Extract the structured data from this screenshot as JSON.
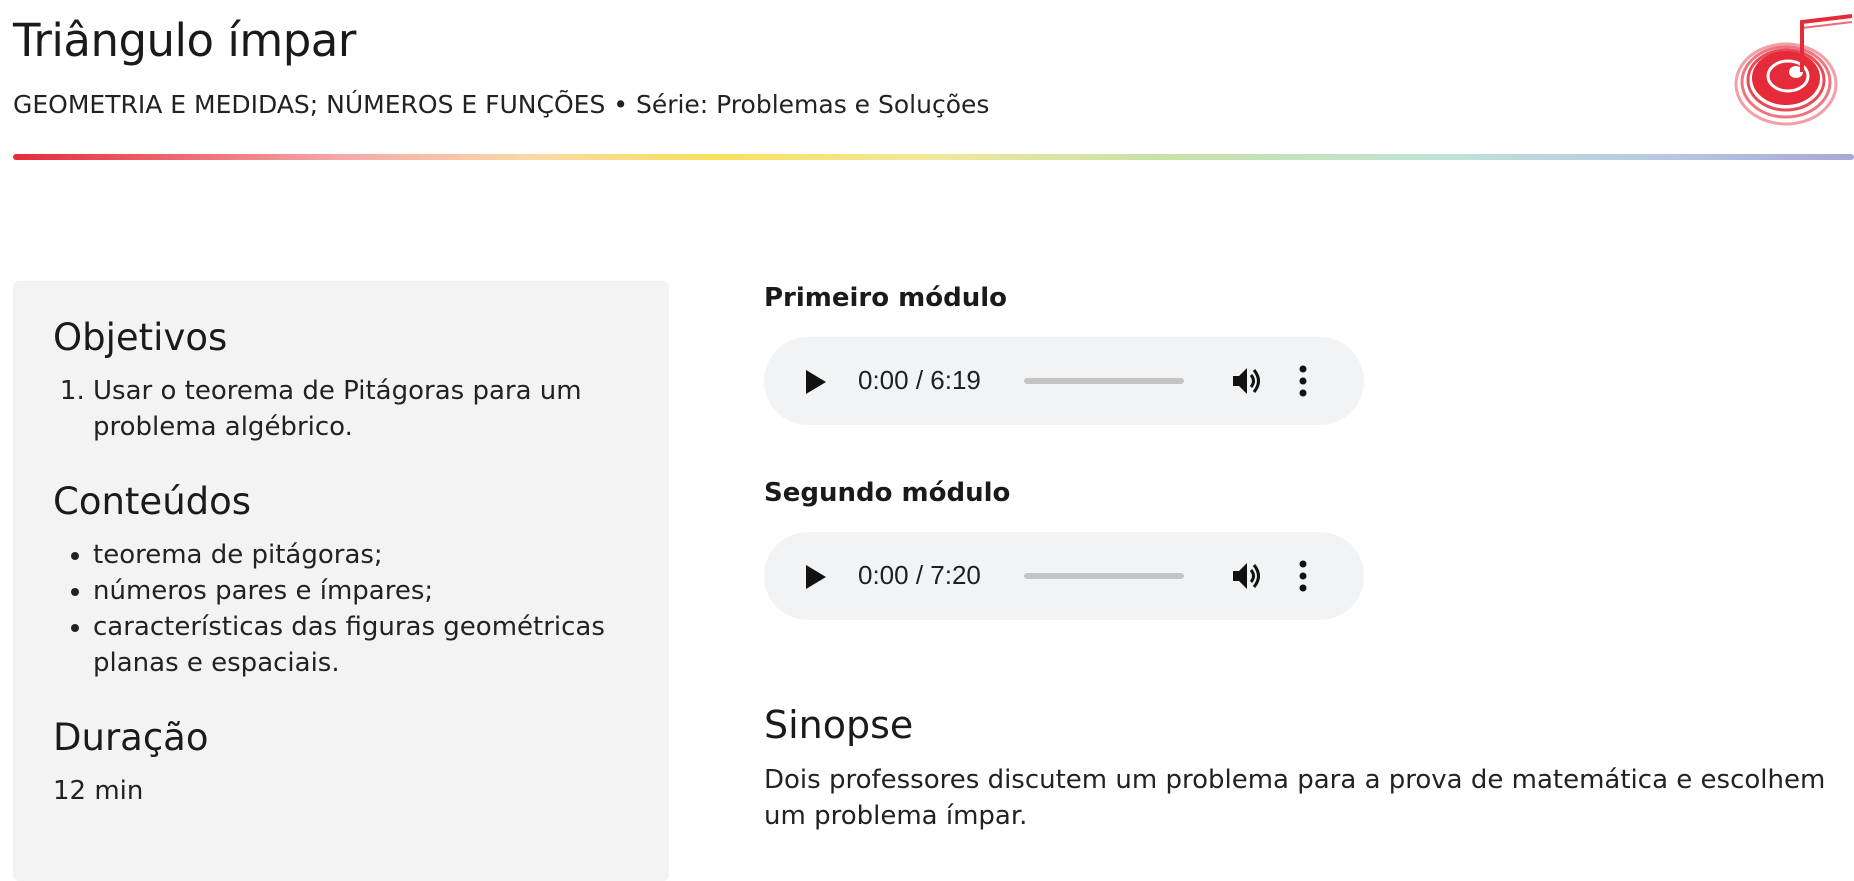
{
  "header": {
    "title": "Triângulo ímpar",
    "subtitle": "GEOMETRIA E MEDIDAS; NÚMEROS E FUNÇÕES • Série: Problemas e Soluções",
    "logo_icon": "music-note-disc-logo"
  },
  "colors": {
    "accent_red": "#e52a39",
    "sidebar_bg": "#f3f3f3",
    "player_bg": "#f1f3f4"
  },
  "sidebar": {
    "objetivos": {
      "heading": "Objetivos",
      "items": [
        "Usar o teorema de Pitágoras para um problema algébrico."
      ]
    },
    "conteudos": {
      "heading": "Conteúdos",
      "items": [
        "teorema de pitágoras;",
        "números pares e ímpares;",
        "características das figuras geométricas planas e espaciais."
      ]
    },
    "duracao": {
      "heading": "Duração",
      "value": "12 min"
    }
  },
  "modules": [
    {
      "label": "Primeiro módulo",
      "time": "0:00 / 6:19",
      "progress": 0,
      "play_icon": "play-icon",
      "volume_icon": "volume-icon",
      "menu_icon": "more-vertical-icon"
    },
    {
      "label": "Segundo módulo",
      "time": "0:00 / 7:20",
      "progress": 0,
      "play_icon": "play-icon",
      "volume_icon": "volume-icon",
      "menu_icon": "more-vertical-icon"
    }
  ],
  "sinopse": {
    "heading": "Sinopse",
    "text": "Dois professores discutem um problema para a prova de matemática e escolhem um problema ímpar."
  }
}
